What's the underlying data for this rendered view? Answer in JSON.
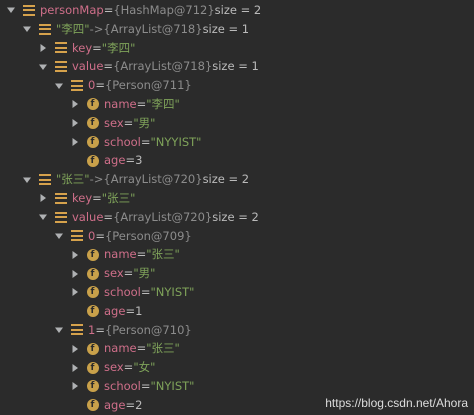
{
  "tree": [
    {
      "depth": 0,
      "expanded": true,
      "icon": "bars",
      "name": "personMap",
      "eq": " = ",
      "type_ref": "{HashMap@712}",
      "size": "  size = 2"
    },
    {
      "depth": 1,
      "expanded": true,
      "icon": "bars",
      "key_str": "\"李四\"",
      "arrow": " -> ",
      "type_ref": "{ArrayList@718}",
      "size": "  size = 1"
    },
    {
      "depth": 2,
      "expanded": false,
      "icon": "bars",
      "name": "key",
      "eq": " = ",
      "str": "\"李四\""
    },
    {
      "depth": 2,
      "expanded": true,
      "icon": "bars",
      "name": "value",
      "eq": " = ",
      "type_ref": "{ArrayList@718}",
      "size": "  size = 1"
    },
    {
      "depth": 3,
      "expanded": true,
      "icon": "bars",
      "name": "0",
      "eq": " = ",
      "type_ref": "{Person@711}"
    },
    {
      "depth": 4,
      "expanded": false,
      "icon": "f",
      "name": "name",
      "eq": " = ",
      "str": "\"李四\""
    },
    {
      "depth": 4,
      "expanded": false,
      "icon": "f",
      "name": "sex",
      "eq": " = ",
      "str": "\"男\""
    },
    {
      "depth": 4,
      "expanded": false,
      "icon": "f",
      "name": "school",
      "eq": " = ",
      "str": "\"NYYIST\""
    },
    {
      "depth": 4,
      "leaf": true,
      "icon": "f",
      "name": "age",
      "eq": " = ",
      "num": "3"
    },
    {
      "depth": 1,
      "expanded": true,
      "icon": "bars",
      "key_str": "\"张三\"",
      "arrow": " -> ",
      "type_ref": "{ArrayList@720}",
      "size": "  size = 2"
    },
    {
      "depth": 2,
      "expanded": false,
      "icon": "bars",
      "name": "key",
      "eq": " = ",
      "str": "\"张三\""
    },
    {
      "depth": 2,
      "expanded": true,
      "icon": "bars",
      "name": "value",
      "eq": " = ",
      "type_ref": "{ArrayList@720}",
      "size": "  size = 2"
    },
    {
      "depth": 3,
      "expanded": true,
      "icon": "bars",
      "name": "0",
      "eq": " = ",
      "type_ref": "{Person@709}"
    },
    {
      "depth": 4,
      "expanded": false,
      "icon": "f",
      "name": "name",
      "eq": " = ",
      "str": "\"张三\""
    },
    {
      "depth": 4,
      "expanded": false,
      "icon": "f",
      "name": "sex",
      "eq": " = ",
      "str": "\"男\""
    },
    {
      "depth": 4,
      "expanded": false,
      "icon": "f",
      "name": "school",
      "eq": " = ",
      "str": "\"NYIST\""
    },
    {
      "depth": 4,
      "leaf": true,
      "icon": "f",
      "name": "age",
      "eq": " = ",
      "num": "1"
    },
    {
      "depth": 3,
      "expanded": true,
      "icon": "bars",
      "name": "1",
      "eq": " = ",
      "type_ref": "{Person@710}"
    },
    {
      "depth": 4,
      "expanded": false,
      "icon": "f",
      "name": "name",
      "eq": " = ",
      "str": "\"张三\""
    },
    {
      "depth": 4,
      "expanded": false,
      "icon": "f",
      "name": "sex",
      "eq": " = ",
      "str": "\"女\""
    },
    {
      "depth": 4,
      "expanded": false,
      "icon": "f",
      "name": "school",
      "eq": " = ",
      "str": "\"NYIST\""
    },
    {
      "depth": 4,
      "leaf": true,
      "icon": "f",
      "name": "age",
      "eq": " = ",
      "num": "2"
    }
  ],
  "watermark": "https://blog.csdn.net/Ahora",
  "colors": {
    "background": "#2b2b2b",
    "field_name": "#cf6f8a",
    "string_value": "#7fa35a",
    "type_ref": "#8c8c8c",
    "icon_gold": "#c9a14a"
  }
}
